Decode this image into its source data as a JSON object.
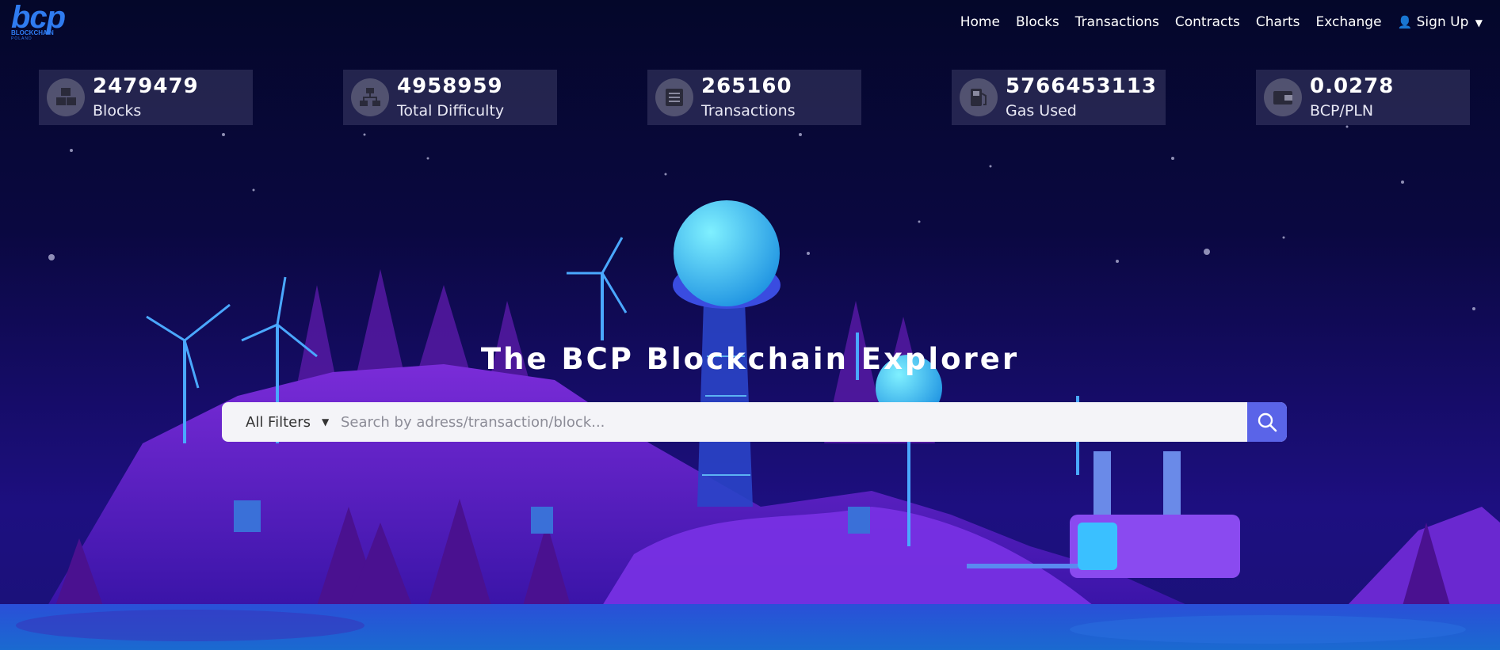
{
  "brand": {
    "logo_text": "bcp",
    "tagline": "BLOCKCHAIN",
    "region": "POLAND"
  },
  "nav": {
    "home": "Home",
    "blocks": "Blocks",
    "transactions": "Transactions",
    "contracts": "Contracts",
    "charts": "Charts",
    "exchange": "Exchange",
    "signup": "Sign Up"
  },
  "stats": [
    {
      "value": "2479479",
      "label": "Blocks",
      "icon": "cubes-icon"
    },
    {
      "value": "4958959",
      "label": "Total Difficulty",
      "icon": "network-icon"
    },
    {
      "value": "265160",
      "label": "Transactions",
      "icon": "list-icon"
    },
    {
      "value": "5766453113",
      "label": "Gas Used",
      "icon": "fuel-pump-icon"
    },
    {
      "value": "0.0278",
      "label": "BCP/PLN",
      "icon": "wallet-icon"
    }
  ],
  "hero": {
    "title": "The BCP Blockchain Explorer",
    "filter_label": "All Filters",
    "search_placeholder": "Search by adress/transaction/block..."
  },
  "colors": {
    "accent": "#5a64e8",
    "logo": "#2f7bf0"
  }
}
